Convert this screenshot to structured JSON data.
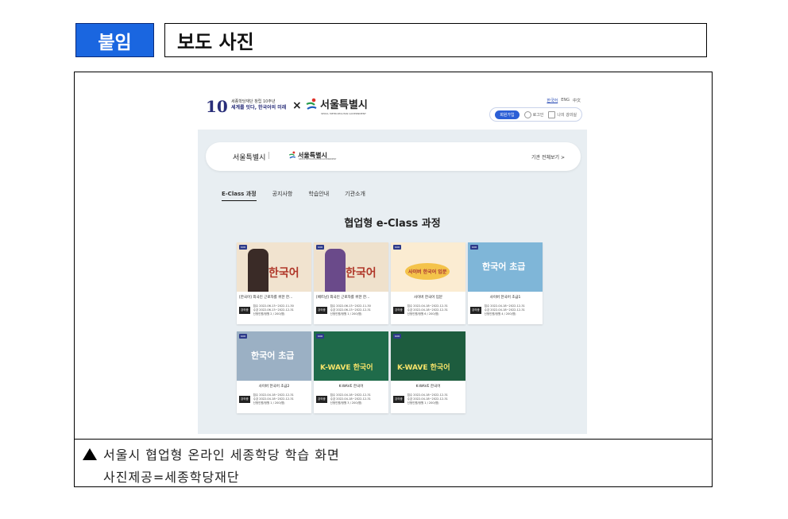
{
  "doc": {
    "tag": "붙임",
    "title": "보도 사진",
    "caption_line1": "서울시 협업형 온라인 세종학당 학습 화면",
    "caption_line2": "사진제공=세종학당재단"
  },
  "site": {
    "brand_line1": "세종학당재단 창립 10주년",
    "brand_line2": "세계를 잇다, 한국어의 미래",
    "brand_number": "10",
    "times": "×",
    "seoul_ko": "서울특별시",
    "seoul_en": "SEOUL METROPOLITAN GOVERNMENT",
    "lang": [
      "한국어",
      "ENG",
      "中文"
    ],
    "join": "회원가입",
    "login": "로그인",
    "myroom": "나의 강의실"
  },
  "panel": {
    "org_name": "서울특별시",
    "sep": "|",
    "all_link": "기관 전체보기 >",
    "tabs": [
      "E-Class 과정",
      "공지사항",
      "학습안내",
      "기관소개"
    ],
    "heading": "협업형 e-Class 과정"
  },
  "cards": [
    {
      "title": "[한국어] 외국인 근로자를 위한 한...",
      "badge": "강의중",
      "line1": "접수  2022-06-13~2022-11-30",
      "line2": "수강  2022-06-13~2022-12-31",
      "line3": "신청인원/정원   2 / 200(명)",
      "img_text": "한국어",
      "bg": "#f1e3cf"
    },
    {
      "title": "[베트남] 외국인 근로자를 위한 한...",
      "badge": "강의중",
      "line1": "접수  2022-06-13~2022-11-30",
      "line2": "수강  2022-06-13~2022-12-31",
      "line3": "신청인원/정원   1 / 200(명)",
      "img_text": "한국어",
      "bg": "#efe1cc"
    },
    {
      "title": "사이버 한국어 입문",
      "badge": "강의중",
      "line1": "접수  2022-04-18~2022-12-31",
      "line2": "수강  2022-04-18~2022-12-31",
      "line3": "신청인원/정원   6 / 200(명)",
      "img_text": "사이버 한국어 입문",
      "bg": "#fbecd2"
    },
    {
      "title": "사이버 한국어 초급1",
      "badge": "강의중",
      "line1": "접수  2022-04-18~2022-12-31",
      "line2": "수강  2022-04-18~2022-12-31",
      "line3": "신청인원/정원   4 / 200(명)",
      "img_text": "한국어 초급",
      "bg": "#7fb6d8"
    },
    {
      "title": "사이버 한국어 초급2",
      "badge": "강의중",
      "line1": "접수  2022-04-18~2022-12-31",
      "line2": "수강  2022-04-18~2022-12-31",
      "line3": "신청인원/정원   1 / 200(명)",
      "img_text": "한국어 초급",
      "bg": "#9bb0c4"
    },
    {
      "title": "K-WAVE 한국어",
      "badge": "강의중",
      "line1": "접수  2022-04-18~2022-12-31",
      "line2": "수강  2022-04-18~2022-12-31",
      "line3": "신청인원/정원   3 / 200(명)",
      "img_text": "K-WAVE 한국어",
      "bg": "#1f6b4a"
    },
    {
      "title": "K-WAVE 한국어",
      "badge": "강의중",
      "line1": "접수  2022-04-18~2022-12-31",
      "line2": "수강  2022-04-18~2022-12-31",
      "line3": "신청인원/정원   1 / 200(명)",
      "img_text": "K-WAVE 한국어",
      "bg": "#1d5c3e"
    }
  ],
  "icons": [
    "triangle-bullet-icon",
    "seoul-symbol-icon",
    "user-icon",
    "classroom-icon"
  ]
}
